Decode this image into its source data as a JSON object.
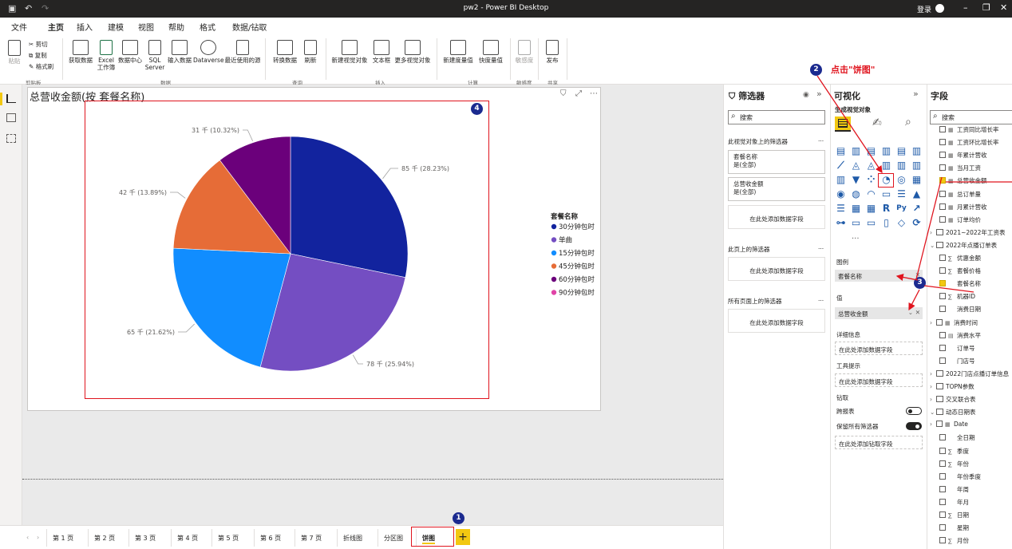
{
  "window": {
    "title": "pw2 - Power BI Desktop",
    "login": "登录"
  },
  "menu": {
    "tabs": [
      "文件",
      "主页",
      "插入",
      "建模",
      "视图",
      "帮助",
      "格式",
      "数据/钻取"
    ],
    "active": "主页"
  },
  "ribbon": {
    "clipboard": {
      "paste": "粘贴",
      "cut": "剪切",
      "copy": "复制",
      "format_painter": "格式刷",
      "group": "剪贴板"
    },
    "data": {
      "get_data": "获取数据",
      "excel": "Excel\n工作簿",
      "datahub": "数据中心",
      "sql": "SQL\nServer",
      "enter": "输入数据",
      "dataverse": "Dataverse",
      "recent": "最近使用的源",
      "group": "数据"
    },
    "query": {
      "transform": "转换数据",
      "refresh": "刷新",
      "group": "查询"
    },
    "insert": {
      "new_visual": "新建视觉对象",
      "textbox": "文本框",
      "more_visuals": "更多视觉对象",
      "group": "插入"
    },
    "calc": {
      "new_measure": "新建度量值",
      "quick_measure": "快度量值",
      "group": "计算"
    },
    "sensitivity": {
      "label": "敏感度",
      "group": "敏感度"
    },
    "share": {
      "publish": "发布",
      "group": "共享"
    }
  },
  "visual": {
    "title": "总营收金额(按 套餐名称)",
    "legend_title": "套餐名称"
  },
  "chart_data": {
    "type": "pie",
    "legend_title": "套餐名称",
    "legend_position": "right",
    "slices": [
      {
        "name": "30分钟包时",
        "value": 85,
        "label": "85 千 (28.23%)",
        "color": "#12239e"
      },
      {
        "name": "单曲",
        "value": 78,
        "label": "78 千 (25.94%)",
        "color": "#744ec2"
      },
      {
        "name": "15分钟包时",
        "value": 65,
        "label": "65 千 (21.62%)",
        "color": "#118dff"
      },
      {
        "name": "45分钟包时",
        "value": 42,
        "label": "42 千 (13.89%)",
        "color": "#e66c37"
      },
      {
        "name": "60分钟包时",
        "value": 31,
        "label": "31 千 (10.32%)",
        "color": "#6b007b"
      }
    ],
    "extra_legend": [
      {
        "name": "90分钟包时",
        "color": "#e044a7"
      }
    ]
  },
  "pages": {
    "tabs": [
      "第 1 页",
      "第 2 页",
      "第 3 页",
      "第 4 页",
      "第 5 页",
      "第 6 页",
      "第 7 页",
      "折线图",
      "分区图",
      "饼图"
    ],
    "active": "饼图",
    "add": "+"
  },
  "filters": {
    "title": "筛选器",
    "search": "搜索",
    "on_visual": "此视觉对象上的筛选器",
    "cards": [
      {
        "name": "套餐名称",
        "value": "是(全部)"
      },
      {
        "name": "总营收金额",
        "value": "是(全部)"
      }
    ],
    "add_field": "在此处添加数据字段",
    "on_page": "此页上的筛选器",
    "on_all": "所有页面上的筛选器",
    "dots": "..."
  },
  "viz": {
    "title": "可视化",
    "subtitle": "生成视觉对象",
    "wells": {
      "legend": "图例",
      "legend_field": "套餐名称",
      "values": "值",
      "values_field": "总营收金额",
      "details": "详细信息",
      "tooltips": "工具提示",
      "add_field": "在此处添加数据字段",
      "drill": "钻取",
      "cross_report": "跨报表",
      "keep_filters": "保留所有筛选器",
      "drill_add": "在此处添加钻取字段"
    },
    "more": "..."
  },
  "fields": {
    "title": "字段",
    "search": "搜索",
    "items": [
      {
        "label": "工资同比增长率",
        "indent": 1,
        "checked": false,
        "type": "▦"
      },
      {
        "label": "工资环比增长率",
        "indent": 1,
        "checked": false,
        "type": "▦"
      },
      {
        "label": "年累计营收",
        "indent": 1,
        "checked": false,
        "type": "▦"
      },
      {
        "label": "当月工资",
        "indent": 1,
        "checked": false,
        "type": "▦"
      },
      {
        "label": "总营收金额",
        "indent": 1,
        "checked": true,
        "type": "▦"
      },
      {
        "label": "总订单量",
        "indent": 1,
        "checked": false,
        "type": "▦"
      },
      {
        "label": "月累计营收",
        "indent": 1,
        "checked": false,
        "type": "▦"
      },
      {
        "label": "订单均价",
        "indent": 1,
        "checked": false,
        "type": "▦"
      },
      {
        "label": "2021~2022年工资表",
        "indent": 0,
        "table": true,
        "expand": "›"
      },
      {
        "label": "2022年点播订单表",
        "indent": 0,
        "table": true,
        "expand": "⌄"
      },
      {
        "label": "优惠金额",
        "indent": 1,
        "checked": false,
        "type": "∑"
      },
      {
        "label": "套餐价格",
        "indent": 1,
        "checked": false,
        "type": "∑"
      },
      {
        "label": "套餐名称",
        "indent": 1,
        "checked": true,
        "type": ""
      },
      {
        "label": "机器ID",
        "indent": 1,
        "checked": false,
        "type": "∑"
      },
      {
        "label": "消费日期",
        "indent": 1,
        "checked": false,
        "type": ""
      },
      {
        "label": "消费时间",
        "indent": 1,
        "checked": false,
        "type": "▦",
        "expand": "›"
      },
      {
        "label": "消费水平",
        "indent": 1,
        "checked": false,
        "type": "▤"
      },
      {
        "label": "订单号",
        "indent": 1,
        "checked": false,
        "type": ""
      },
      {
        "label": "门店号",
        "indent": 1,
        "checked": false,
        "type": ""
      },
      {
        "label": "2022门店点播订单信息",
        "indent": 0,
        "table": true,
        "expand": "›"
      },
      {
        "label": "TOPN参数",
        "indent": 0,
        "table": true,
        "expand": "›"
      },
      {
        "label": "交叉联合表",
        "indent": 0,
        "table": true,
        "expand": "›"
      },
      {
        "label": "动态日期表",
        "indent": 0,
        "table": true,
        "expand": "⌄"
      },
      {
        "label": "Date",
        "indent": 1,
        "checked": false,
        "type": "▦",
        "expand": "›"
      },
      {
        "label": "全日期",
        "indent": 1,
        "checked": false,
        "type": ""
      },
      {
        "label": "季度",
        "indent": 1,
        "checked": false,
        "type": "∑"
      },
      {
        "label": "年份",
        "indent": 1,
        "checked": false,
        "type": "∑"
      },
      {
        "label": "年份季度",
        "indent": 1,
        "checked": false,
        "type": ""
      },
      {
        "label": "年周",
        "indent": 1,
        "checked": false,
        "type": ""
      },
      {
        "label": "年月",
        "indent": 1,
        "checked": false,
        "type": ""
      },
      {
        "label": "日期",
        "indent": 1,
        "checked": false,
        "type": "∑"
      },
      {
        "label": "星期",
        "indent": 1,
        "checked": false,
        "type": ""
      },
      {
        "label": "月份",
        "indent": 1,
        "checked": false,
        "type": "∑"
      }
    ]
  },
  "annotations": {
    "step1": "1",
    "step2": "2",
    "step2_text": "点击\"饼图\"",
    "step3": "3",
    "step4": "4"
  },
  "colors": {
    "accent": "#f2c811",
    "annotation_red": "#e0141e",
    "badge": "#1b2a8f"
  }
}
